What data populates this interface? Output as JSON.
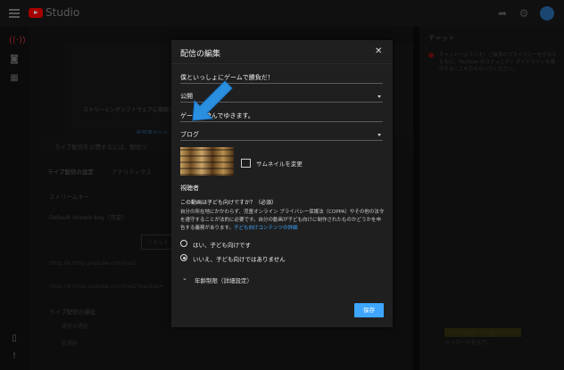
{
  "app": {
    "name": "Studio"
  },
  "chat": {
    "title": "チャット",
    "welcome": "チャットへようこそ！ご自身のプライバシーを守るとともに、YouTube のコミュニティ ガイドラインを遵守することを忘れないでください。",
    "tag": "WPで同じ趣ゲーム番付するのか",
    "input_placeholder": "メッセージを入力..."
  },
  "background": {
    "preview_text": "ストリーミングソフトウェアに接続してライブ配信を",
    "preview_link": "配信者のヘルプ",
    "notice": "ライブ配信を公開するには、配信ソ",
    "tab_settings": "ライブ配信の設定",
    "tab_analytics": "アナリティクス",
    "stream_key_heading": "ストリームキー",
    "stream_key_value": "Default stream key（可変）",
    "reset_button": "リセット",
    "url1": "rtmp://a.rtmp.youtube.com/live2",
    "url2": "rtmp://b.rtmp.youtube.com/live2?backup=",
    "latency_heading": "ライブ配信の遅延",
    "latency_normal": "通常の遅延",
    "latency_low": "低遅延"
  },
  "dialog": {
    "title": "配信の編集",
    "stream_title": "僕といっしょにゲームで勝負だ！",
    "visibility": "公開",
    "description": "ゲームで遊んでゆきます。",
    "category": "ブログ",
    "thumbnail_change": "サムネイルを変更",
    "audience_heading": "視聴者",
    "kids_question": "この動画は子ども向けですか？（必須）",
    "kids_description": "自分の所在地にかかわらず、児童オンライン プライバシー保護法（COPPA）やその他の法令を遵守することが法的に必要です。自分の動画が子ども向けに制作されたものかどうかを申告する義務があります。",
    "kids_link": "子ども向けコンテンツの詳細",
    "option_yes": "はい、子ども向けです",
    "option_no": "いいえ、子ども向けではありません",
    "age_restriction": "年齢制限（詳細設定）",
    "save": "保存"
  },
  "colors": {
    "accent": "#3ea6ff",
    "arrow": "#2b8fe0",
    "brand": "#ff0000"
  }
}
